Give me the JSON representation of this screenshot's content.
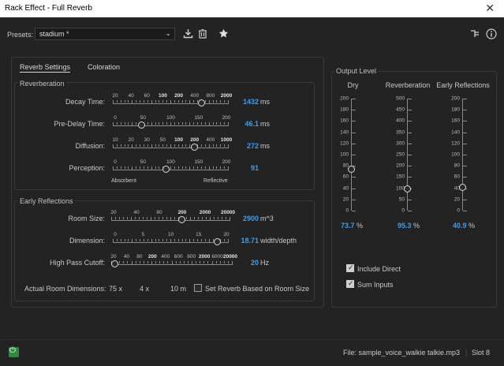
{
  "window": {
    "title": "Rack Effect - Full Reverb",
    "close_label": "✕"
  },
  "presets": {
    "label": "Presets:",
    "value": "stadium *",
    "chevron": "⌄"
  },
  "toolbar": {
    "icons": [
      "download-icon",
      "trash-icon",
      "star-icon",
      "routing-icon",
      "info-icon"
    ]
  },
  "tabs": [
    {
      "label": "Reverb Settings"
    },
    {
      "label": "Coloration"
    }
  ],
  "reverberation": {
    "title": "Reverberation",
    "decay": {
      "label": "Decay Time:",
      "ticks": [
        "20",
        "40",
        "60",
        "100",
        "200",
        "400",
        "800",
        "2000"
      ],
      "value": "1432",
      "unit": "ms",
      "level": 0.78
    },
    "predelay": {
      "label": "Pre-Delay Time:",
      "ticks": [
        "0",
        "50",
        "100",
        "150",
        "200"
      ],
      "value": "46.1",
      "unit": "ms",
      "level": 0.23
    },
    "diffusion": {
      "label": "Diffusion:",
      "ticks": [
        "10",
        "20",
        "30",
        "50",
        "100",
        "200",
        "400",
        "1000"
      ],
      "value": "272",
      "unit": "ms",
      "level": 0.72
    },
    "perception": {
      "label": "Perception:",
      "ticks": [
        "0",
        "50",
        "100",
        "150",
        "200"
      ],
      "value": "91",
      "unit": "",
      "level": 0.455,
      "left_note": "Absorbent",
      "right_note": "Reflective"
    }
  },
  "early": {
    "title": "Early Reflections",
    "room_size": {
      "label": "Room Size:",
      "ticks": [
        "20",
        "40",
        "80",
        "200",
        "2000",
        "20000"
      ],
      "value": "2900",
      "unit": "m^3",
      "level": 0.6
    },
    "dimension": {
      "label": "Dimension:",
      "ticks": [
        "0",
        "5",
        "10",
        "15",
        "20"
      ],
      "value": "18.71",
      "unit": "width/depth",
      "level": 0.93
    },
    "high_pass": {
      "label": "High Pass Cutoff:",
      "ticks": [
        "20",
        "40",
        "80",
        "200",
        "400",
        "600",
        "800",
        "2000",
        "6000",
        "20000"
      ],
      "value": "20",
      "unit": "Hz",
      "level": 0.0
    },
    "dims_label": "Actual Room Dimensions:",
    "dims_w": "75 x",
    "dims_d": "4 x",
    "dims_h": "10 m",
    "set_reverb_label": "Set Reverb Based on Room Size"
  },
  "output": {
    "title": "Output Level",
    "dry": {
      "label": "Dry",
      "value": "73.7",
      "unit": "%",
      "scale": [
        "200",
        "180",
        "160",
        "140",
        "120",
        "100",
        "80",
        "60",
        "40",
        "20",
        "0"
      ],
      "level": 0.737
    },
    "reverb": {
      "label": "Reverberation",
      "value": "95.3",
      "unit": "%",
      "scale": [
        "500",
        "450",
        "400",
        "350",
        "300",
        "250",
        "200",
        "150",
        "100",
        "50",
        "0"
      ],
      "level": 0.953
    },
    "early_ref": {
      "label": "Early Reflections",
      "value": "40.9",
      "unit": "%",
      "scale": [
        "200",
        "180",
        "160",
        "140",
        "120",
        "100",
        "80",
        "60",
        "40",
        "20",
        "0"
      ],
      "level": 0.409
    },
    "include_direct": "Include Direct",
    "sum_inputs": "Sum  Inputs"
  },
  "status": {
    "file": "File: sample_voice_walkie talkie.mp3",
    "slot": "Slot 8"
  },
  "colors": {
    "accent": "#3d9ef0",
    "power": "#2e8b3e",
    "background": "#232323"
  }
}
